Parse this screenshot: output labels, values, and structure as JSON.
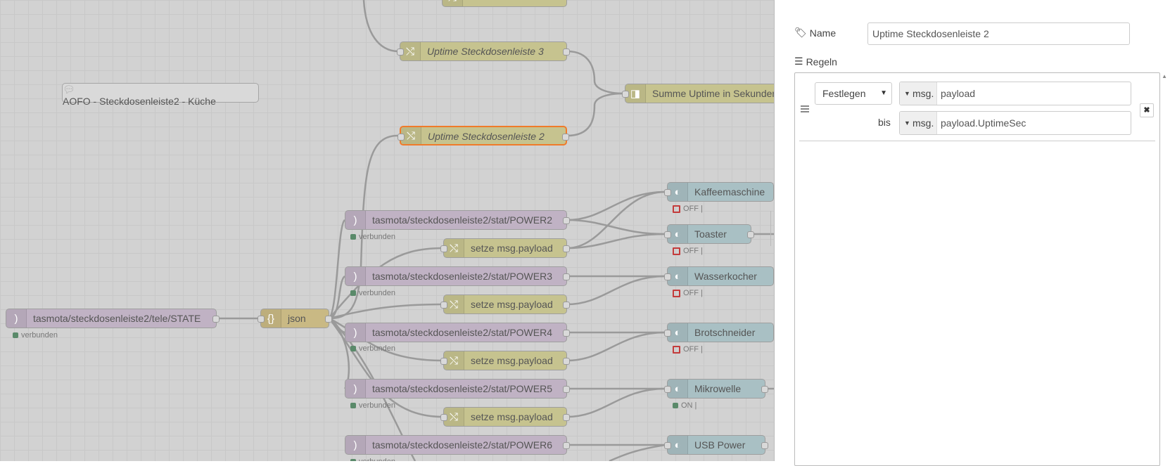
{
  "canvas": {
    "comment": "AOFO - Steckdosenleiste2 - Küche",
    "nodes": {
      "change_top": "",
      "uptime3": "Uptime Steckdosenleiste 3",
      "summe": "Summe Uptime in Sekunden",
      "uptime2": "Uptime Steckdosenleiste 2",
      "tele_state": "tasmota/steckdosenleiste2/tele/STATE",
      "json": "json",
      "power2": "tasmota/steckdosenleiste2/stat/POWER2",
      "power3": "tasmota/steckdosenleiste2/stat/POWER3",
      "power4": "tasmota/steckdosenleiste2/stat/POWER4",
      "power5": "tasmota/steckdosenleiste2/stat/POWER5",
      "power6": "tasmota/steckdosenleiste2/stat/POWER6",
      "setze": "setze msg.payload",
      "kaffee": "Kaffeemaschine",
      "toaster": "Toaster",
      "wasser": "Wasserkocher",
      "brot": "Brotschneider",
      "mikro": "Mikrowelle",
      "usb": "USB Power"
    },
    "status": {
      "connected": "verbunden",
      "off": "OFF |",
      "on": "ON |"
    }
  },
  "panel": {
    "name_label": "Name",
    "name_value": "Uptime Steckdosenleiste 2",
    "rules_label": "Regeln",
    "rule": {
      "action": "Festlegen",
      "type1": "msg.",
      "value1": "payload",
      "to_label": "bis",
      "type2": "msg.",
      "value2": "payload.UptimeSec"
    }
  },
  "colors": {
    "mqtt": "#c0b2c4",
    "change": "#c6c38f",
    "switch": "#a9c0c4",
    "selected": "#f07a2a"
  }
}
